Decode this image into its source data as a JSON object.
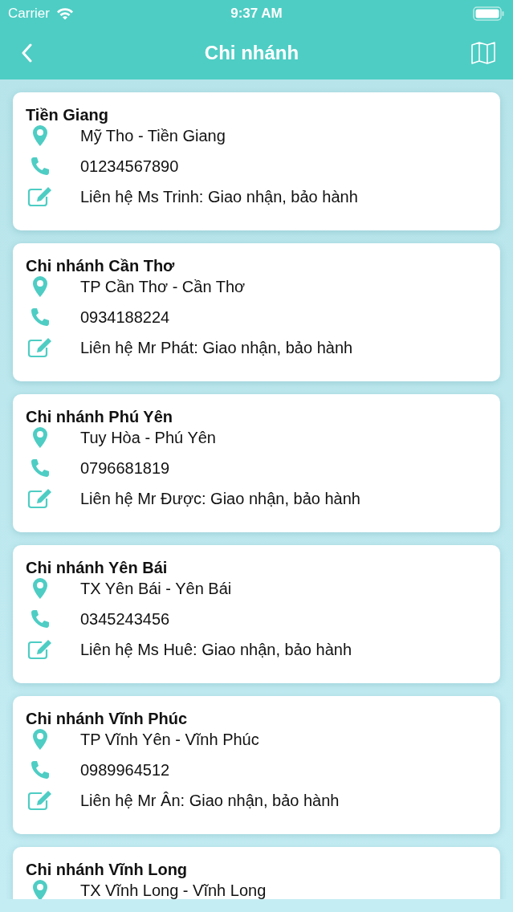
{
  "status_bar": {
    "carrier": "Carrier",
    "time": "9:37 AM"
  },
  "nav": {
    "title": "Chi nhánh"
  },
  "branches": [
    {
      "name": "Tiền Giang",
      "address": "Mỹ Tho - Tiền Giang",
      "phone": "01234567890",
      "contact": "Liên hệ Ms Trinh: Giao nhận, bảo hành"
    },
    {
      "name": "Chi nhánh Cần Thơ",
      "address": "TP Cần Thơ - Cần Thơ",
      "phone": "0934188224",
      "contact": "Liên hệ Mr Phát: Giao nhận, bảo hành"
    },
    {
      "name": "Chi nhánh Phú Yên",
      "address": "Tuy Hòa - Phú Yên",
      "phone": "0796681819",
      "contact": "Liên hệ Mr Được: Giao nhận, bảo hành"
    },
    {
      "name": "Chi nhánh Yên Bái",
      "address": "TX Yên Bái - Yên Bái",
      "phone": "0345243456",
      "contact": "Liên hệ Ms Huê: Giao nhận, bảo hành"
    },
    {
      "name": "Chi nhánh Vĩnh Phúc",
      "address": "TP Vĩnh Yên - Vĩnh Phúc",
      "phone": "0989964512",
      "contact": "Liên hệ Mr Ân: Giao nhận, bảo hành"
    },
    {
      "name": "Chi nhánh Vĩnh Long",
      "address": "TX Vĩnh Long - Vĩnh Long"
    }
  ]
}
